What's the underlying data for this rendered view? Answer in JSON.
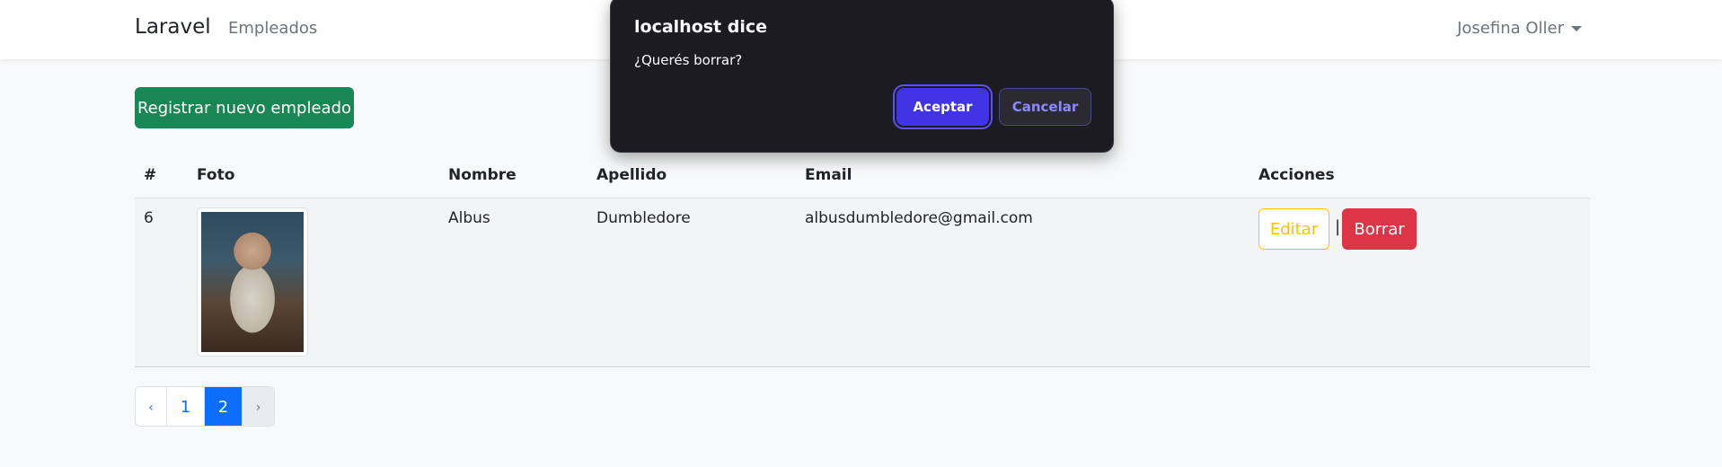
{
  "navbar": {
    "brand": "Laravel",
    "links": [
      "Empleados"
    ],
    "user": "Josefina Oller"
  },
  "actions": {
    "new_label": "Registrar nuevo empleado"
  },
  "table": {
    "headers": [
      "#",
      "Foto",
      "Nombre",
      "Apellido",
      "Email",
      "Acciones"
    ],
    "rows": [
      {
        "id": "6",
        "nombre": "Albus",
        "apellido": "Dumbledore",
        "email": "albusdumbledore@gmail.com",
        "edit_label": "Editar",
        "separator": "|",
        "delete_label": "Borrar"
      }
    ]
  },
  "pagination": {
    "prev": "‹",
    "pages": [
      "1",
      "2"
    ],
    "active": "2",
    "next": "›"
  },
  "dialog": {
    "title": "localhost dice",
    "message": "¿Querés borrar?",
    "ok_label": "Aceptar",
    "cancel_label": "Cancelar"
  },
  "colors": {
    "primary": "#0d6efd",
    "success": "#198754",
    "warning": "#ffc107",
    "danger": "#dc3545",
    "dialog_bg": "#1c1b22",
    "dialog_accent": "#4034e4"
  }
}
